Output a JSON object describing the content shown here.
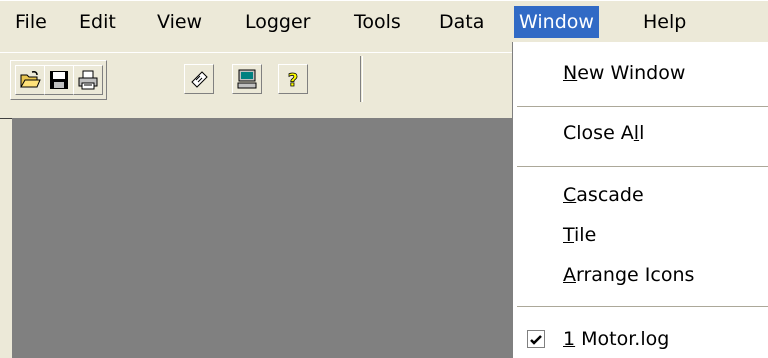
{
  "menubar": {
    "items": [
      {
        "label": "File"
      },
      {
        "label": "Edit"
      },
      {
        "label": "View"
      },
      {
        "label": "Logger"
      },
      {
        "label": "Tools"
      },
      {
        "label": "Data"
      },
      {
        "label": "Window"
      },
      {
        "label": "Help"
      }
    ],
    "active_item": "Window"
  },
  "toolbar": {
    "buttons": [
      "open-icon",
      "save-icon",
      "print-icon",
      "logger-icon",
      "computer-icon",
      "help-icon"
    ]
  },
  "window_menu": {
    "new_window": {
      "pre": "",
      "mnemonic": "N",
      "post": "ew Window"
    },
    "close_all": {
      "pre": "Close A",
      "mnemonic": "l",
      "post": "l"
    },
    "cascade": {
      "pre": "",
      "mnemonic": "C",
      "post": "ascade"
    },
    "tile": {
      "pre": "",
      "mnemonic": "T",
      "post": "ile"
    },
    "arrange_icons": {
      "pre": "",
      "mnemonic": "A",
      "post": "rrange Icons"
    },
    "recent_window": {
      "pre": "",
      "mnemonic": "1",
      "post": " Motor.log",
      "checked": true
    }
  },
  "colors": {
    "menu_highlight": "#316ac5",
    "workspace": "#808080",
    "chrome": "#ece9d8"
  }
}
